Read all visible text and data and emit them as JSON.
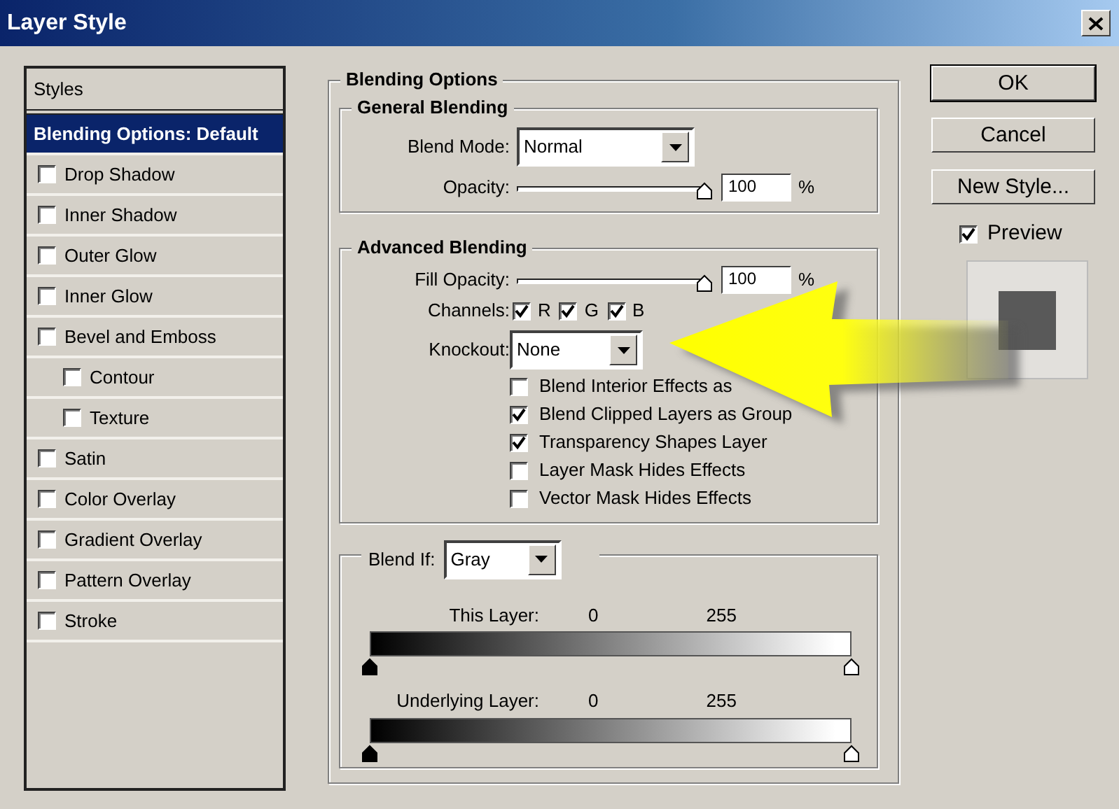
{
  "window": {
    "title": "Layer Style"
  },
  "styles": {
    "header": "Styles",
    "items": [
      {
        "label": "Blending Options: Default",
        "kind": "heading",
        "selected": true
      },
      {
        "label": "Drop Shadow",
        "kind": "checkbox",
        "checked": false,
        "selected": false
      },
      {
        "label": "Inner Shadow",
        "kind": "checkbox",
        "checked": false,
        "selected": false
      },
      {
        "label": "Outer Glow",
        "kind": "checkbox",
        "checked": false,
        "selected": false
      },
      {
        "label": "Inner Glow",
        "kind": "checkbox",
        "checked": false,
        "selected": false
      },
      {
        "label": "Bevel and Emboss",
        "kind": "checkbox",
        "checked": false,
        "selected": false,
        "children": [
          {
            "label": "Contour",
            "kind": "checkbox",
            "checked": false,
            "selected": false
          },
          {
            "label": "Texture",
            "kind": "checkbox",
            "checked": false,
            "selected": false
          }
        ]
      },
      {
        "label": "Satin",
        "kind": "checkbox",
        "checked": false,
        "selected": false
      },
      {
        "label": "Color Overlay",
        "kind": "checkbox",
        "checked": false,
        "selected": false
      },
      {
        "label": "Gradient Overlay",
        "kind": "checkbox",
        "checked": false,
        "selected": false
      },
      {
        "label": "Pattern Overlay",
        "kind": "checkbox",
        "checked": false,
        "selected": false
      },
      {
        "label": "Stroke",
        "kind": "checkbox",
        "checked": false,
        "selected": false
      }
    ]
  },
  "blending_options": {
    "title": "Blending Options",
    "general": {
      "title": "General Blending",
      "blend_mode": {
        "label": "Blend Mode:",
        "value": "Normal"
      },
      "opacity": {
        "label": "Opacity:",
        "level": 1,
        "value": "100",
        "unit": "%"
      }
    },
    "advanced": {
      "title": "Advanced Blending",
      "fill_opacity": {
        "label": "Fill Opacity:",
        "level": 1,
        "value": "100",
        "unit": "%"
      },
      "channels": {
        "label": "Channels:",
        "items": [
          {
            "label": "R",
            "checked": true
          },
          {
            "label": "G",
            "checked": true
          },
          {
            "label": "B",
            "checked": true
          }
        ]
      },
      "knockout": {
        "label": "Knockout:",
        "value": "None"
      },
      "options": [
        {
          "label": "Blend Interior Effects as",
          "checked": false
        },
        {
          "label": "Blend Clipped Layers as Group",
          "checked": true
        },
        {
          "label": "Transparency Shapes Layer",
          "checked": true
        },
        {
          "label": "Layer Mask Hides Effects",
          "checked": false
        },
        {
          "label": "Vector Mask Hides Effects",
          "checked": false
        }
      ]
    },
    "blend_if": {
      "label": "Blend If:",
      "value": "Gray",
      "ranges": [
        {
          "label": "This Layer:",
          "low": "0",
          "high": "255"
        },
        {
          "label": "Underlying Layer:",
          "low": "0",
          "high": "255"
        }
      ]
    }
  },
  "buttons": [
    {
      "label": "OK",
      "default": true
    },
    {
      "label": "Cancel",
      "default": false
    },
    {
      "label": "New Style...",
      "default": false
    }
  ],
  "preview": {
    "label": "Preview",
    "checked": true
  }
}
